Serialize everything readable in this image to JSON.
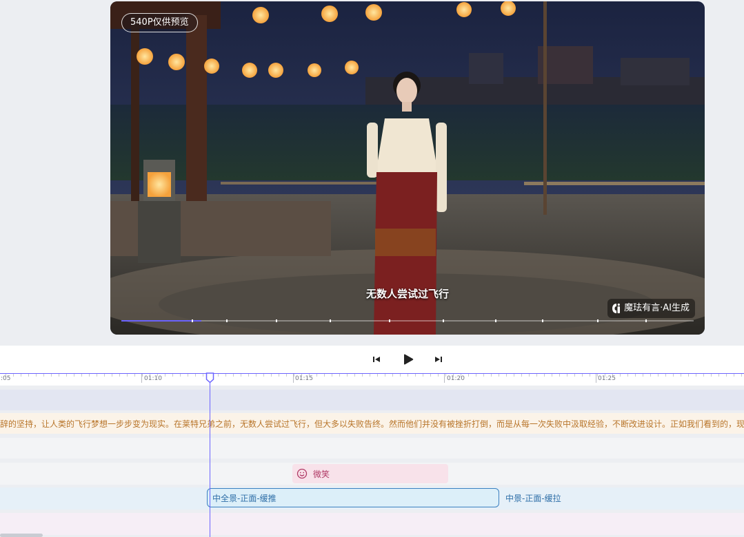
{
  "preview": {
    "resolution_badge": "540P仅供预览",
    "subtitle": "无数人尝试过飞行",
    "watermark": "魔珐有言·AI生成",
    "progress": 0.14
  },
  "controls": {
    "prev_icon": "skip-back-icon",
    "play_icon": "play-icon",
    "next_icon": "skip-forward-icon"
  },
  "timeline": {
    "ruler_labels": [
      ":05",
      "01:10",
      "01:15",
      "01:20",
      "01:25"
    ],
    "script_text": "辞的坚持，让人类的飞行梦想一步步变为现实。在莱特兄弟之前，无数人尝试过飞行，但大多以失败告终。然而他们并没有被挫折打倒，而是从每一次失败中汲取经验，不断改进设计。正如我们看到的，现代",
    "expression_clip": {
      "icon": "smile-icon",
      "label": "微笑"
    },
    "camera_clips": [
      {
        "label": "中全景-正面-缓推"
      },
      {
        "label": "中景-正面-缓拉"
      }
    ]
  },
  "colors": {
    "accent": "#6b63ff",
    "script": "#b8752a",
    "expression": "#b03a66",
    "camera": "#2f6fa8"
  }
}
